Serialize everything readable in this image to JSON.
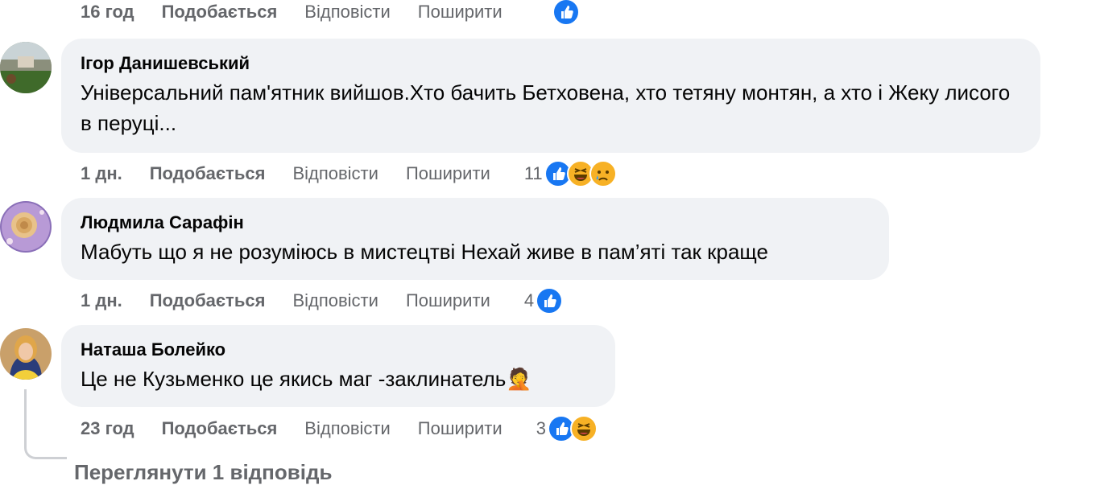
{
  "top_actions": {
    "time": "16 год",
    "like": "Подобається",
    "reply": "Відповісти",
    "share": "Поширити"
  },
  "comments": [
    {
      "author": "Ігор Данишевський",
      "text": "Універсальний пам'ятник вийшов.Хто бачить Бетховена, хто тетяну монтян, а хто і Жеку лисого в перуці...",
      "time": "1 дн.",
      "like": "Подобається",
      "reply": "Відповісти",
      "share": "Поширити",
      "reaction_count": "11",
      "reactions": [
        "like-icon",
        "haha-icon",
        "sad-icon"
      ]
    },
    {
      "author": "Людмила Сарафін",
      "text": "Мабуть що я не розуміюсь в мистецтві Нехай живе в пам’яті так краще",
      "time": "1 дн.",
      "like": "Подобається",
      "reply": "Відповісти",
      "share": "Поширити",
      "reaction_count": "4",
      "reactions": [
        "like-icon"
      ]
    },
    {
      "author": "Наташа Болейко",
      "text": "Це не Кузьменко це якись маг -заклинатель",
      "emoji": "🤦",
      "time": "23 год",
      "like": "Подобається",
      "reply": "Відповісти",
      "share": "Поширити",
      "reaction_count": "3",
      "reactions": [
        "like-icon",
        "haha-icon"
      ]
    }
  ],
  "view_replies": "Переглянути 1 відповідь",
  "colors": {
    "like_blue": "#1877f2",
    "emoji_yellow": "#f7b125",
    "bubble_bg": "#f0f2f5",
    "meta_gray": "#65676b"
  }
}
